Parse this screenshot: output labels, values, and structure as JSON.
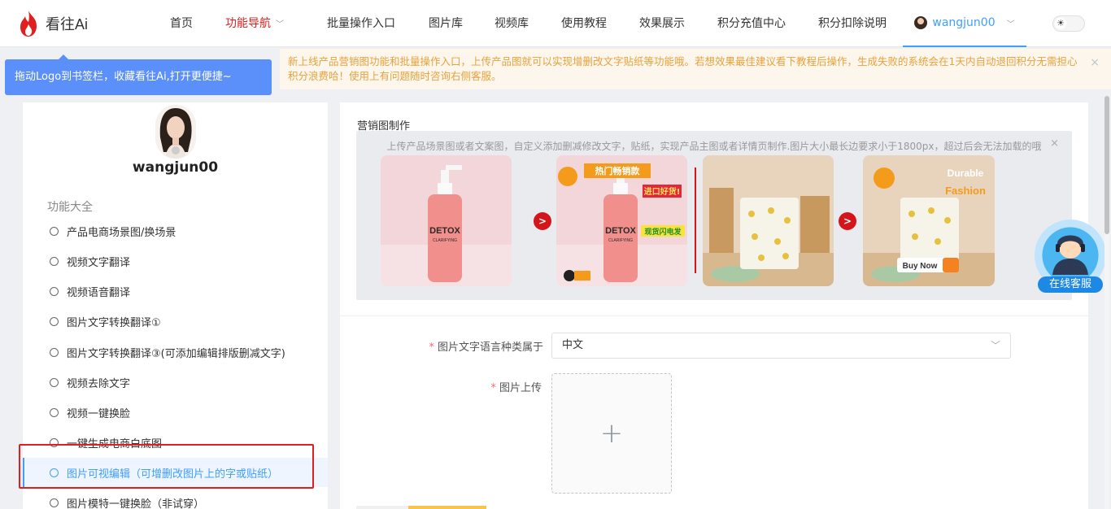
{
  "header": {
    "logo_text": "看往Ai",
    "nav": [
      {
        "label": "首页"
      },
      {
        "label": "功能导航",
        "active": true
      },
      {
        "label": "批量操作入口"
      },
      {
        "label": "图片库"
      },
      {
        "label": "视频库"
      },
      {
        "label": "使用教程"
      },
      {
        "label": "效果展示"
      },
      {
        "label": "积分充值中心"
      },
      {
        "label": "积分扣除说明"
      }
    ],
    "username": "wangjun00",
    "theme_icon": "sun-icon"
  },
  "bookmark_tip": "拖动Logo到书签栏，收藏看往Ai,打开更便捷~",
  "notice": {
    "text": "新上线产品营销图功能和批量操作入口，上传产品图就可以实现增删改文字贴纸等功能哦。若想效果最佳建议看下教程后操作，生成失败的系统会在1天内自动退回积分无需担心积分浪费哈！使用上有问题随时咨询右侧客服。",
    "close": "×"
  },
  "sidebar": {
    "username": "wangjun00",
    "section_title": "功能大全",
    "items": [
      {
        "label": "产品电商场景图/换场景"
      },
      {
        "label": "视频文字翻译"
      },
      {
        "label": "视频语音翻译"
      },
      {
        "label": "图片文字转换翻译①"
      },
      {
        "label": "图片文字转换翻译③(可添加编辑排版删减文字)"
      },
      {
        "label": "视频去除文字"
      },
      {
        "label": "视频一键换脸"
      },
      {
        "label": "一键生成电商白底图"
      },
      {
        "label": "图片可视编辑（可增删改图片上的字或贴纸）",
        "active": true
      },
      {
        "label": "图片模特一键换脸（非试穿）"
      }
    ]
  },
  "main": {
    "title": "营销图制作",
    "banner": {
      "description": "上传产品场景图或者文案图，自定义添加删减修改文字，贴纸，实现产品主图或者详情页制作.图片大小最长边要求小于1800px，超过后会无法加载的哦",
      "close": "×",
      "sample1": {
        "brand": "DETOX",
        "sub": "CLARIFYING"
      },
      "sample2": {
        "brand": "DETOX",
        "sub": "CLARIFYING",
        "sticker_top": "热门畅销款",
        "sticker_mid": "进口好货!",
        "sticker_bottom": "现货闪电发"
      },
      "sample4": {
        "line1": "Durable",
        "line2": "Fashion",
        "button": "Buy Now"
      }
    },
    "form": {
      "language_label": "图片文字语言种类属于",
      "language_value": "中文",
      "upload_label": "图片上传",
      "required_mark": "*"
    }
  },
  "cs_widget": {
    "label": "在线客服"
  },
  "colors": {
    "accent": "#409eff",
    "brand_red": "#e02020",
    "notice_text": "#e6a23c"
  }
}
